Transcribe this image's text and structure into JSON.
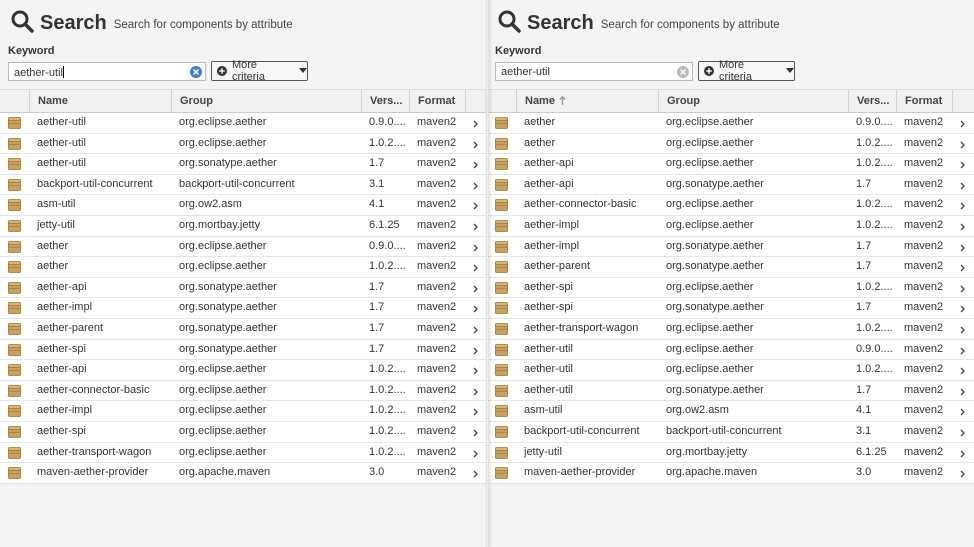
{
  "colors": {
    "accent": "#3d7fcc",
    "package_icon": "#c9a15a"
  },
  "panels": [
    {
      "id": "left",
      "header": {
        "title": "Search",
        "subtitle": "Search for components by attribute",
        "icon": "search-icon"
      },
      "keyword": {
        "label": "Keyword",
        "value": "aether-util",
        "focused": true
      },
      "more_criteria_label": "More criteria",
      "columns": [
        {
          "key": "name",
          "label": "Name",
          "sorted": false
        },
        {
          "key": "group",
          "label": "Group",
          "sorted": false
        },
        {
          "key": "version",
          "label": "Vers...",
          "sorted": false
        },
        {
          "key": "format",
          "label": "Format",
          "sorted": false
        }
      ],
      "rows": [
        {
          "name": "aether-util",
          "group": "org.eclipse.aether",
          "version": "0.9.0....",
          "format": "maven2"
        },
        {
          "name": "aether-util",
          "group": "org.eclipse.aether",
          "version": "1.0.2....",
          "format": "maven2"
        },
        {
          "name": "aether-util",
          "group": "org.sonatype.aether",
          "version": "1.7",
          "format": "maven2"
        },
        {
          "name": "backport-util-concurrent",
          "group": "backport-util-concurrent",
          "version": "3.1",
          "format": "maven2"
        },
        {
          "name": "asm-util",
          "group": "org.ow2.asm",
          "version": "4.1",
          "format": "maven2"
        },
        {
          "name": "jetty-util",
          "group": "org.mortbay.jetty",
          "version": "6.1.25",
          "format": "maven2"
        },
        {
          "name": "aether",
          "group": "org.eclipse.aether",
          "version": "0.9.0....",
          "format": "maven2"
        },
        {
          "name": "aether",
          "group": "org.eclipse.aether",
          "version": "1.0.2....",
          "format": "maven2"
        },
        {
          "name": "aether-api",
          "group": "org.sonatype.aether",
          "version": "1.7",
          "format": "maven2"
        },
        {
          "name": "aether-impl",
          "group": "org.sonatype.aether",
          "version": "1.7",
          "format": "maven2"
        },
        {
          "name": "aether-parent",
          "group": "org.sonatype.aether",
          "version": "1.7",
          "format": "maven2"
        },
        {
          "name": "aether-spi",
          "group": "org.sonatype.aether",
          "version": "1.7",
          "format": "maven2"
        },
        {
          "name": "aether-api",
          "group": "org.eclipse.aether",
          "version": "1.0.2....",
          "format": "maven2"
        },
        {
          "name": "aether-connector-basic",
          "group": "org.eclipse.aether",
          "version": "1.0.2....",
          "format": "maven2"
        },
        {
          "name": "aether-impl",
          "group": "org.eclipse.aether",
          "version": "1.0.2....",
          "format": "maven2"
        },
        {
          "name": "aether-spi",
          "group": "org.eclipse.aether",
          "version": "1.0.2....",
          "format": "maven2"
        },
        {
          "name": "aether-transport-wagon",
          "group": "org.eclipse.aether",
          "version": "1.0.2....",
          "format": "maven2"
        },
        {
          "name": "maven-aether-provider",
          "group": "org.apache.maven",
          "version": "3.0",
          "format": "maven2"
        }
      ]
    },
    {
      "id": "right",
      "header": {
        "title": "Search",
        "subtitle": "Search for components by attribute",
        "icon": "search-icon"
      },
      "keyword": {
        "label": "Keyword",
        "value": "aether-util",
        "focused": false
      },
      "more_criteria_label": "More criteria",
      "columns": [
        {
          "key": "name",
          "label": "Name",
          "sorted": true
        },
        {
          "key": "group",
          "label": "Group",
          "sorted": false
        },
        {
          "key": "version",
          "label": "Vers...",
          "sorted": false
        },
        {
          "key": "format",
          "label": "Format",
          "sorted": false
        }
      ],
      "rows": [
        {
          "name": "aether",
          "group": "org.eclipse.aether",
          "version": "0.9.0....",
          "format": "maven2"
        },
        {
          "name": "aether",
          "group": "org.eclipse.aether",
          "version": "1.0.2....",
          "format": "maven2"
        },
        {
          "name": "aether-api",
          "group": "org.eclipse.aether",
          "version": "1.0.2....",
          "format": "maven2"
        },
        {
          "name": "aether-api",
          "group": "org.sonatype.aether",
          "version": "1.7",
          "format": "maven2"
        },
        {
          "name": "aether-connector-basic",
          "group": "org.eclipse.aether",
          "version": "1.0.2....",
          "format": "maven2"
        },
        {
          "name": "aether-impl",
          "group": "org.eclipse.aether",
          "version": "1.0.2....",
          "format": "maven2"
        },
        {
          "name": "aether-impl",
          "group": "org.sonatype.aether",
          "version": "1.7",
          "format": "maven2"
        },
        {
          "name": "aether-parent",
          "group": "org.sonatype.aether",
          "version": "1.7",
          "format": "maven2"
        },
        {
          "name": "aether-spi",
          "group": "org.eclipse.aether",
          "version": "1.0.2....",
          "format": "maven2"
        },
        {
          "name": "aether-spi",
          "group": "org.sonatype.aether",
          "version": "1.7",
          "format": "maven2"
        },
        {
          "name": "aether-transport-wagon",
          "group": "org.eclipse.aether",
          "version": "1.0.2....",
          "format": "maven2"
        },
        {
          "name": "aether-util",
          "group": "org.eclipse.aether",
          "version": "0.9.0....",
          "format": "maven2"
        },
        {
          "name": "aether-util",
          "group": "org.eclipse.aether",
          "version": "1.0.2....",
          "format": "maven2"
        },
        {
          "name": "aether-util",
          "group": "org.sonatype.aether",
          "version": "1.7",
          "format": "maven2"
        },
        {
          "name": "asm-util",
          "group": "org.ow2.asm",
          "version": "4.1",
          "format": "maven2"
        },
        {
          "name": "backport-util-concurrent",
          "group": "backport-util-concurrent",
          "version": "3.1",
          "format": "maven2"
        },
        {
          "name": "jetty-util",
          "group": "org.mortbay.jetty",
          "version": "6.1.25",
          "format": "maven2"
        },
        {
          "name": "maven-aether-provider",
          "group": "org.apache.maven",
          "version": "3.0",
          "format": "maven2"
        }
      ]
    }
  ]
}
